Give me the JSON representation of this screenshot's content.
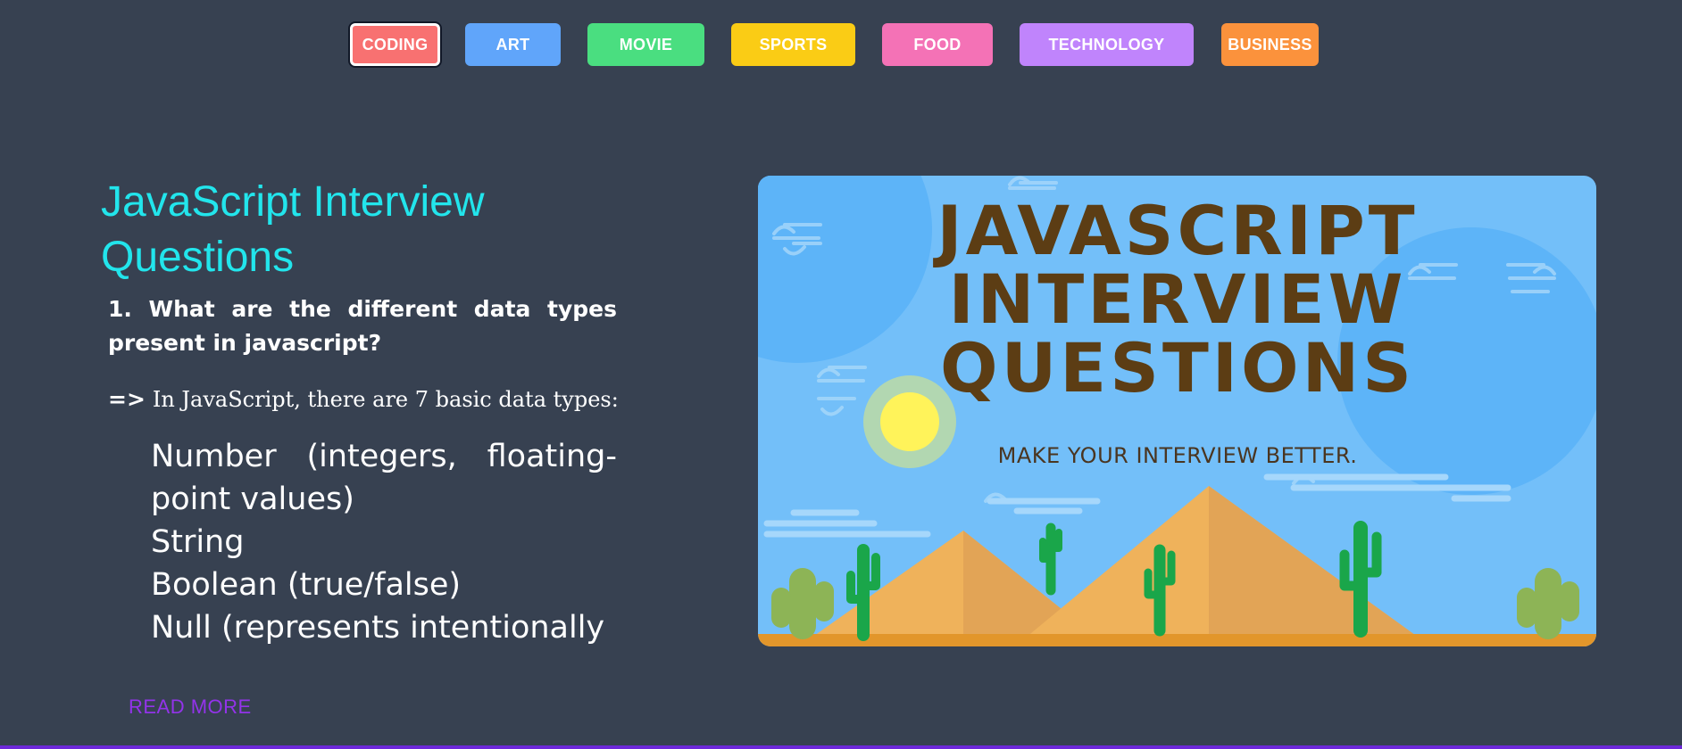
{
  "nav": {
    "categories": [
      {
        "label": "CODING",
        "color": "#f87171",
        "active": true
      },
      {
        "label": "ART",
        "color": "#60a5fa",
        "active": false
      },
      {
        "label": "MOVIE",
        "color": "#4ade80",
        "active": false
      },
      {
        "label": "SPORTS",
        "color": "#facc15",
        "active": false
      },
      {
        "label": "FOOD",
        "color": "#f472b6",
        "active": false
      },
      {
        "label": "TECHNOLOGY",
        "color": "#c084fc",
        "active": false
      },
      {
        "label": "BUSINESS",
        "color": "#fb923c",
        "active": false
      }
    ]
  },
  "article": {
    "title": "JavaScript Interview Questions",
    "question": "1.  What are the different data types present in javascript?",
    "answer_prefix": "=>",
    "answer_text": "In JavaScript, there are 7 basic data types:",
    "types": [
      "Number (integers, floating-point values)",
      "String",
      "Boolean (true/false)",
      "Null (represents intentionally"
    ],
    "read_more": "READ MORE"
  },
  "hero_image": {
    "heading_lines": [
      "JAVASCRIPT",
      "INTERVIEW",
      "QUESTIONS"
    ],
    "tagline": "MAKE YOUR INTERVIEW BETTER.",
    "colors": {
      "sky": "#73bff9",
      "heading": "#5c3d14",
      "sun": "#fff35a",
      "dune": "#efb25b",
      "cactus": "#1aa64a"
    }
  },
  "colors": {
    "background": "#374151",
    "title": "#22e5ec",
    "read_more": "#9333ea"
  }
}
